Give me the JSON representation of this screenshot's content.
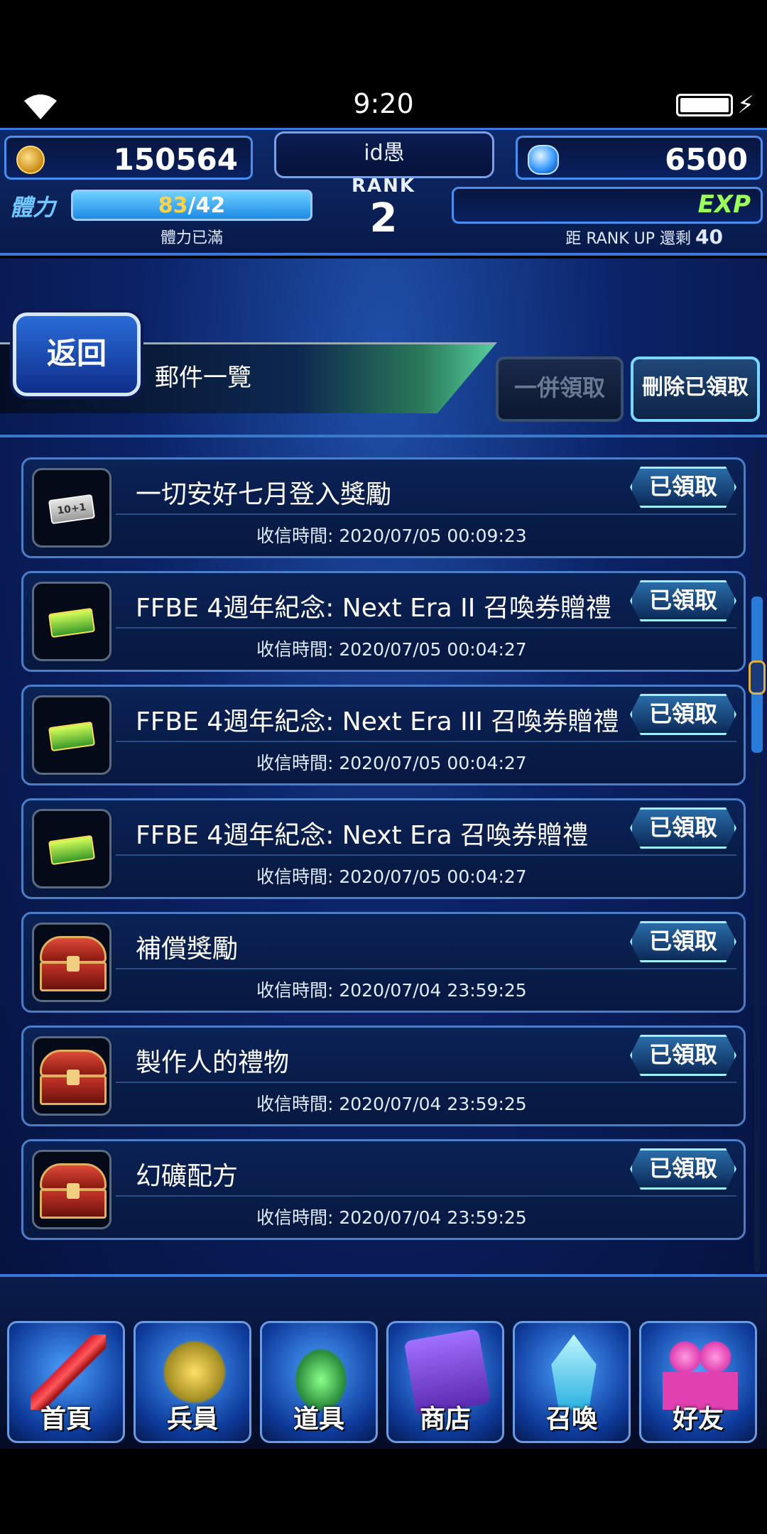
{
  "status_bar": {
    "time": "9:20"
  },
  "hud": {
    "gil": "150564",
    "gems": "6500",
    "player_name": "id愚",
    "rank_label": "RANK",
    "rank_value": "2",
    "stamina_label": "體力",
    "stamina_current": "83",
    "stamina_max": "/42",
    "stamina_status": "體力已滿",
    "exp_label": "EXP",
    "exp_status_prefix": "距 RANK UP 還剩",
    "exp_remaining": "40"
  },
  "header": {
    "back_label": "返回",
    "title": "郵件一覽",
    "claim_all_label": "一併領取",
    "delete_claimed_label": "刪除已領取"
  },
  "mail_items": [
    {
      "title": "一切安好七月登入獎勵",
      "date": "收信時間: 2020/07/05 00:09:23",
      "status": "已領取",
      "icon": "ticket-10plus1-icon",
      "icon_text": "10+1"
    },
    {
      "title": "FFBE 4週年紀念: Next Era II 召喚券贈禮",
      "date": "收信時間: 2020/07/05 00:04:27",
      "status": "已領取",
      "icon": "summon-ticket-icon"
    },
    {
      "title": "FFBE 4週年紀念: Next Era III 召喚券贈禮",
      "date": "收信時間: 2020/07/05 00:04:27",
      "status": "已領取",
      "icon": "summon-ticket-icon"
    },
    {
      "title": "FFBE 4週年紀念: Next Era 召喚券贈禮",
      "date": "收信時間: 2020/07/05 00:04:27",
      "status": "已領取",
      "icon": "summon-ticket-icon"
    },
    {
      "title": "補償獎勵",
      "date": "收信時間: 2020/07/04 23:59:25",
      "status": "已領取",
      "icon": "treasure-chest-icon"
    },
    {
      "title": "製作人的禮物",
      "date": "收信時間: 2020/07/04 23:59:25",
      "status": "已領取",
      "icon": "treasure-chest-icon"
    },
    {
      "title": "幻礦配方",
      "date": "收信時間: 2020/07/04 23:59:25",
      "status": "已領取",
      "icon": "treasure-chest-icon"
    }
  ],
  "nav": {
    "home": "首頁",
    "units": "兵員",
    "items": "道具",
    "shop": "商店",
    "summon": "召喚",
    "friends": "好友"
  },
  "colors": {
    "accent": "#3a78e0",
    "claimed_border": "#9ef0ff",
    "stamina_current": "#ffd24a",
    "exp_label": "#9aff5a"
  }
}
